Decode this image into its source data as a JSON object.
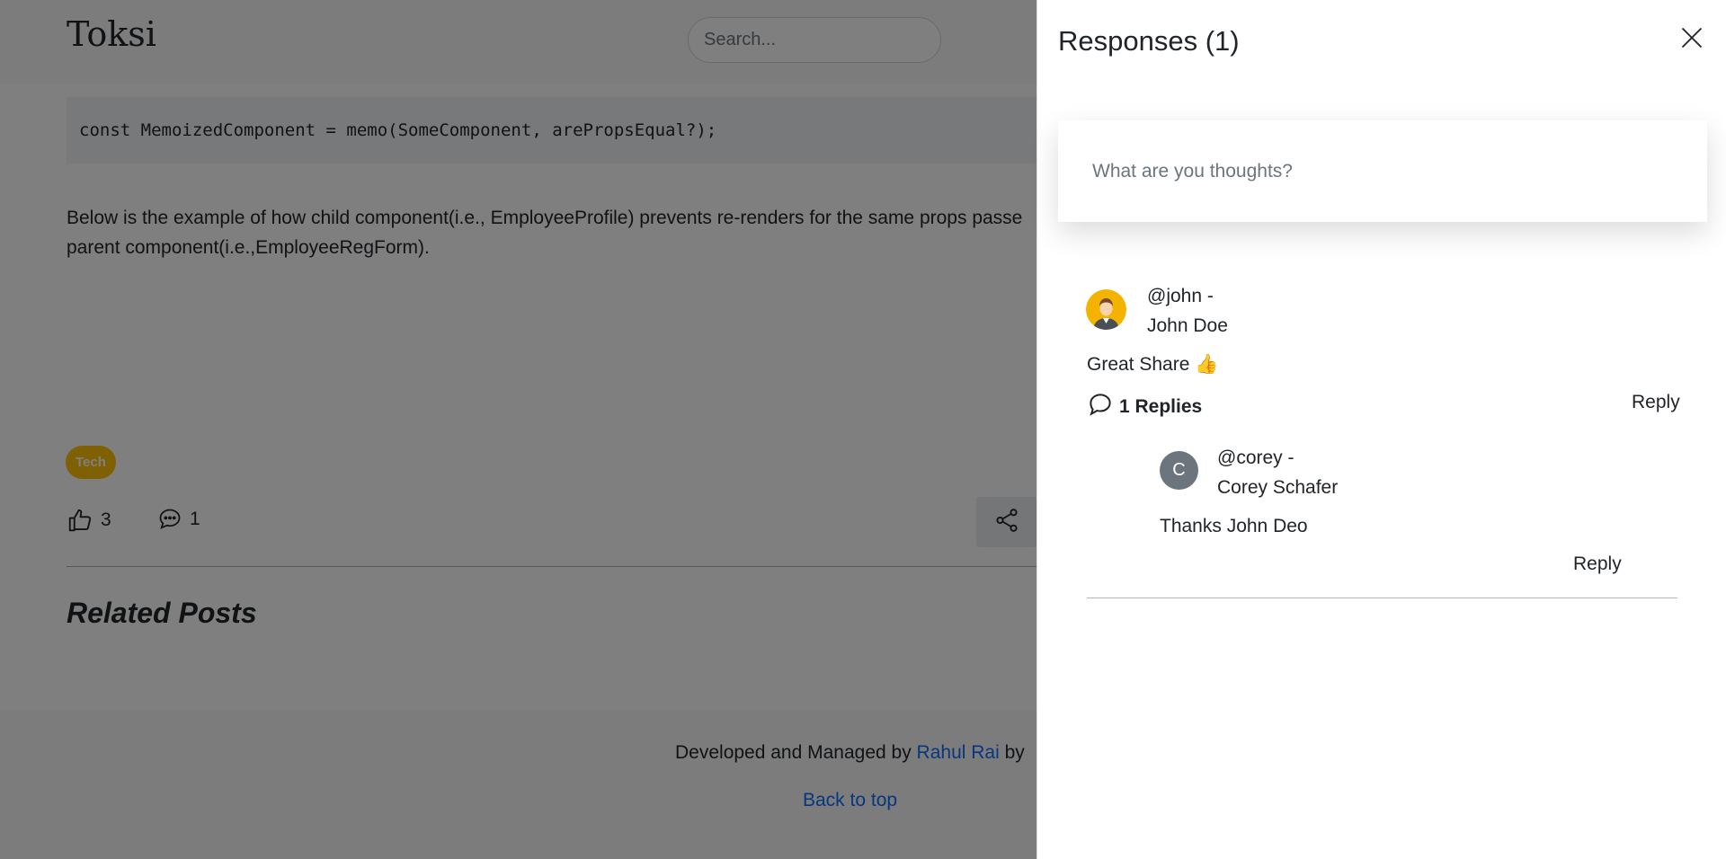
{
  "header": {
    "brand": "Toksi",
    "search_placeholder": "Search..."
  },
  "article": {
    "code": "const MemoizedComponent = memo(SomeComponent, arePropsEqual?);",
    "paragraph": "Below is the example of how child component(i.e., EmployeeProfile) prevents re-renders for the same props passe\nparent component(i.e.,EmployeeRegForm).",
    "tag": "Tech",
    "likes": "3",
    "comments": "1",
    "related_heading": "Related Posts"
  },
  "footer": {
    "prefix": "Developed and Managed by",
    "author_link": "Rahul Rai",
    "suffix": "by",
    "back_to_top": "Back to top"
  },
  "drawer": {
    "title": "Responses (1)",
    "input_placeholder": "What are you thoughts?",
    "comment": {
      "handle": "@john -",
      "name": "John Doe",
      "text": "Great Share 👍",
      "replies_label": "1 Replies",
      "reply_label": "Reply",
      "reply": {
        "avatar_letter": "C",
        "handle": "@corey -",
        "name": "Corey Schafer",
        "text": "Thanks John Deo",
        "reply_label": "Reply"
      }
    }
  },
  "colors": {
    "tag": "#ffc107",
    "link": "#0d6efd",
    "overlay": "rgba(0,0,0,0.5)",
    "avatar_bg": "#6c757d"
  }
}
